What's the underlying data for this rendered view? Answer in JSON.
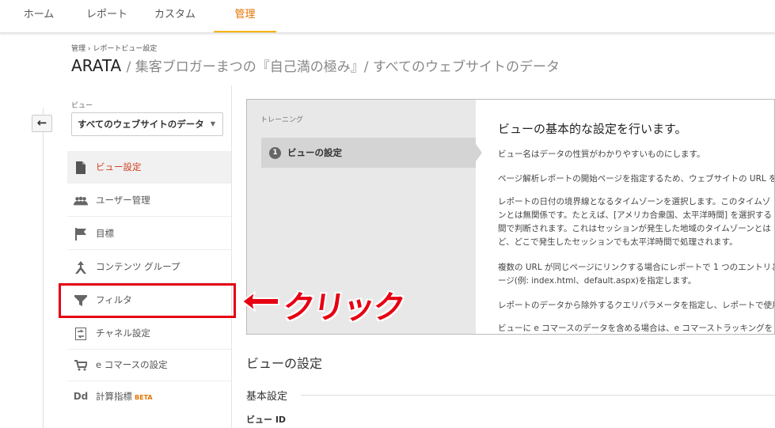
{
  "topnav": {
    "tabs": [
      {
        "label": "ホーム"
      },
      {
        "label": "レポート"
      },
      {
        "label": "カスタム"
      },
      {
        "label": "管理",
        "active": true
      }
    ]
  },
  "breadcrumb": {
    "part1": "管理",
    "separator": "›",
    "part2": "レポートビュー設定"
  },
  "page": {
    "account": "ARATA",
    "subtitle": "/ 集客ブロガーまつの『自己満の極み』/ すべてのウェブサイトのデータ"
  },
  "view": {
    "label": "ビュー",
    "selected": "すべてのウェブサイトのデータ"
  },
  "sidebar": {
    "items": [
      {
        "label": "ビュー設定",
        "icon": "document-icon",
        "active": true
      },
      {
        "label": "ユーザー管理",
        "icon": "people-icon"
      },
      {
        "label": "目標",
        "icon": "flag-icon"
      },
      {
        "label": "コンテンツ グループ",
        "icon": "content-group-icon"
      },
      {
        "label": "フィルタ",
        "icon": "filter-icon"
      },
      {
        "label": "チャネル設定",
        "icon": "channel-icon"
      },
      {
        "label": "e コマースの設定",
        "icon": "cart-icon"
      },
      {
        "label": "計算指標",
        "icon": "dd-icon",
        "badge": "BETA"
      }
    ]
  },
  "training": {
    "label": "トレーニング",
    "step_number": "1",
    "step_label": "ビューの設定",
    "heading": "ビューの基本的な設定を行います。",
    "paragraphs": [
      "ビュー名はデータの性質がわかりやすいものにします。",
      "ページ解析レポートの開始ページを指定するため、ウェブサイトの URL を",
      "レポートの日付の境界線となるタイムゾーンを選択します。このタイムゾ\nンとは無関係です。たとえば、[アメリカ合衆国、太平洋時間] を選択する\n間で判断されます。これはセッションが発生した地域のタイムゾーンとは\nど、どこで発生したセッションでも太平洋時間で処理されます。",
      "複数の URL が同じページにリンクする場合にレポートで 1 つのエントリと\nージ(例: index.html、default.aspx)を指定します。",
      "レポートのデータから除外するクエリパラメータを指定し、レポートで使用",
      "ビューに e コマースのデータを含める場合は、e コマーストラッキングを"
    ]
  },
  "main": {
    "section_title": "ビューの設定",
    "basic_settings": "基本設定",
    "view_id_label": "ビュー ID"
  },
  "annotation": {
    "text": "クリック"
  },
  "colors": {
    "accent": "#e37400",
    "highlight": "#e60012",
    "active_text": "#c1272d"
  }
}
